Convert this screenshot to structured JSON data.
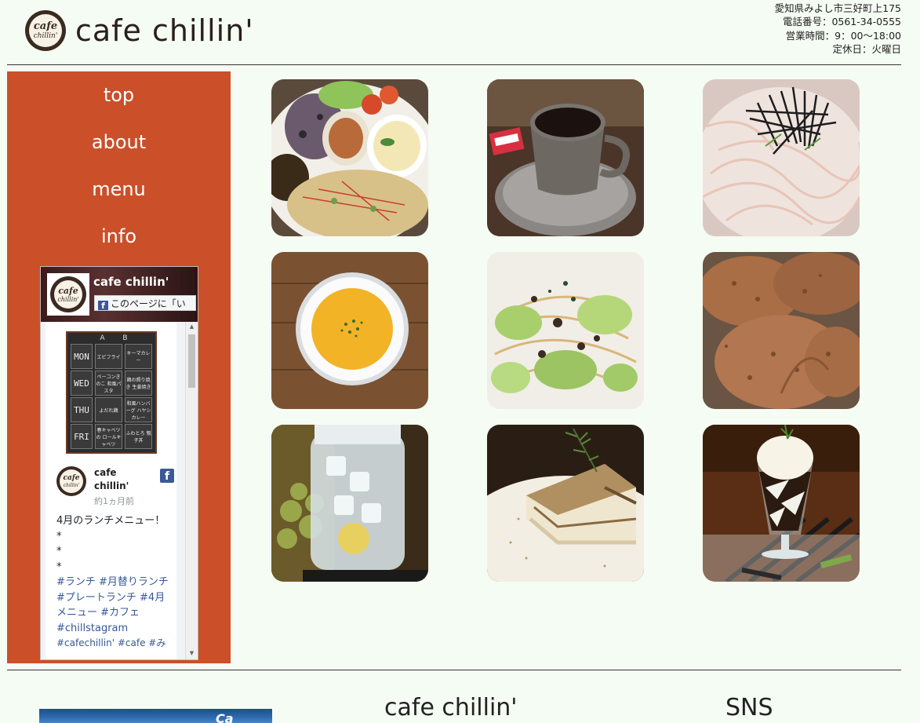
{
  "header": {
    "title": "cafe chillin'",
    "logo_line1": "cafe",
    "logo_line2": "chillin'",
    "address": "愛知県みよし市三好町上175",
    "phone": "電話番号：0561-34-0555",
    "hours": "営業時間：9：00～18:00",
    "closed": "定休日：火曜日"
  },
  "nav": {
    "items": [
      {
        "label": "top"
      },
      {
        "label": "about"
      },
      {
        "label": "menu"
      },
      {
        "label": "info"
      }
    ]
  },
  "facebook": {
    "page_name": "cafe chillin'",
    "like_label": "このページに「い",
    "f_glyph": "f",
    "post": {
      "author": "cafe chillin'",
      "time": "約1ヵ月前",
      "text_line1": "4月のランチメニュー！",
      "star1": "*",
      "star2": "*",
      "star3": "*",
      "hashtags": "#ランチ #月替りランチ #プレートランチ #4月メニュー #カフェ #chillstagram",
      "hashtags_cut": "#cafechillin' #cafe #み"
    },
    "board": {
      "col_a": "A",
      "col_b": "B",
      "rows": [
        {
          "day": "MON",
          "a": "エビフライ",
          "b": "キーマカレー"
        },
        {
          "day": "WED",
          "a": "ベーコンきのこ 和風パスタ",
          "b": "鶏の照り焼き 生姜焼き"
        },
        {
          "day": "THU",
          "a": "よだれ鶏",
          "b": "和風ハンバーグ ハヤシカレー"
        },
        {
          "day": "FRI",
          "a": "春キャベツの ロールキャベツ",
          "b": "ふわとろ 親子丼"
        }
      ]
    }
  },
  "gallery": {
    "photos": [
      {
        "name": "lunch-plate"
      },
      {
        "name": "coffee-cup"
      },
      {
        "name": "mentaiko-pasta"
      },
      {
        "name": "pumpkin-soup"
      },
      {
        "name": "cabbage-pasta"
      },
      {
        "name": "roast-chicken"
      },
      {
        "name": "ume-syrup-jar"
      },
      {
        "name": "tiramisu"
      },
      {
        "name": "coffee-jelly-parfait"
      }
    ]
  },
  "footer": {
    "title": "cafe chillin'",
    "sns": "SNS",
    "photo_sign": "Ca"
  },
  "colors": {
    "background": "#f5fcf3",
    "sidebar": "#cb4f29",
    "facebook_blue": "#3b5998"
  }
}
